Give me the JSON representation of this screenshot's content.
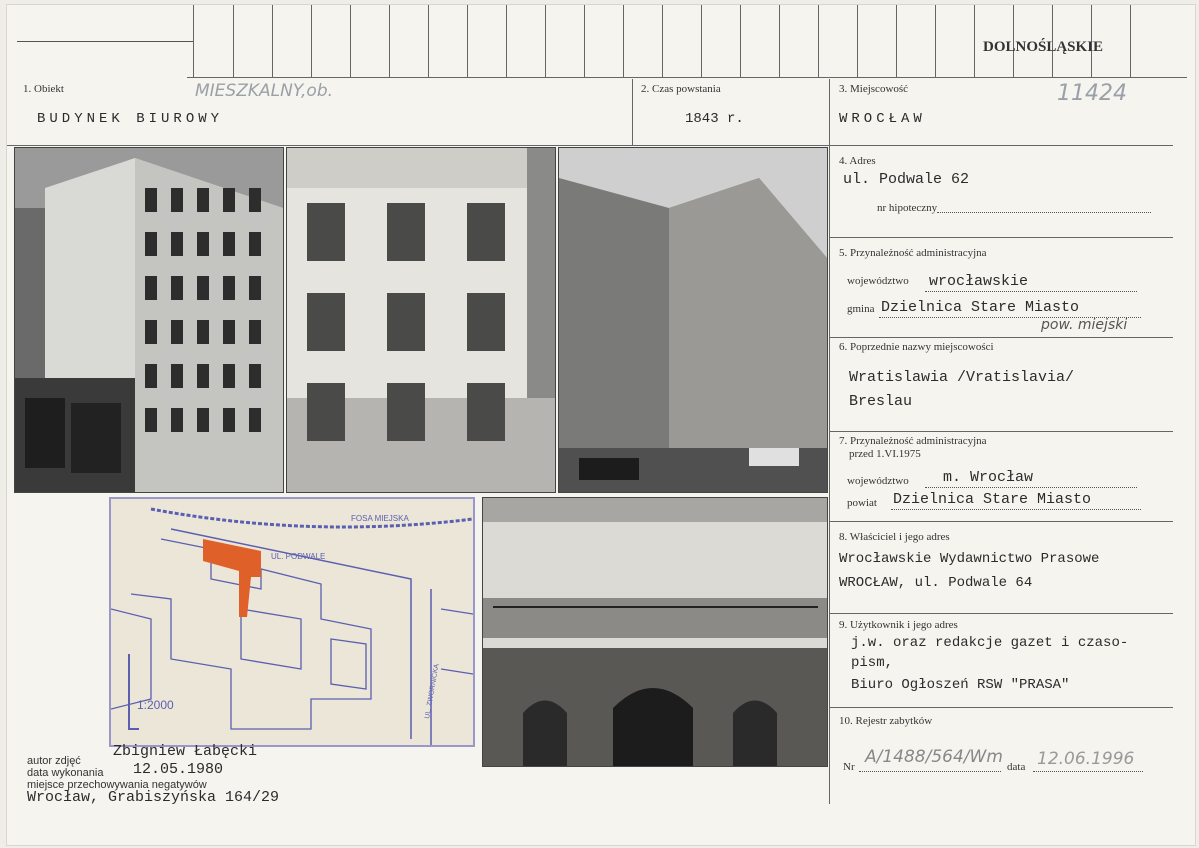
{
  "header": {
    "region_stamp": "DOLNOŚLĄSKIE"
  },
  "fields": {
    "obiekt": {
      "label": "1. Obiekt",
      "value": "BUDYNEK  BIUROWY",
      "hand_note": "MIESZKALNY,ob."
    },
    "czas": {
      "label": "2. Czas powstania",
      "value": "1843 r."
    },
    "miejscowosc": {
      "label": "3. Miejscowość",
      "value": "WROCŁAW",
      "hand_note": "11424"
    },
    "adres": {
      "label": "4. Adres",
      "value": "ul. Podwale 62",
      "sub_label": "nr hipoteczny"
    },
    "przynaleznosc": {
      "label": "5. Przynależność administracyjna",
      "woj_label": "województwo",
      "woj_value": "wrocławskie",
      "gmina_label": "gmina",
      "gmina_value": "Dzielnica Stare Miasto",
      "hand_note": "pow. miejski"
    },
    "poprzednie": {
      "label": "6. Poprzednie nazwy miejscowości",
      "line1": "Wratislawia /Vratislavia/",
      "line2": "Breslau"
    },
    "przynaleznosc_przed": {
      "label": "7. Przynależność administracyjna",
      "label2": "przed 1.VI.1975",
      "woj_label": "województwo",
      "woj_value": "m. Wrocław",
      "powiat_label": "powiat",
      "powiat_value": "Dzielnica Stare Miasto"
    },
    "wlasciciel": {
      "label": "8. Właściciel i jego adres",
      "line1": "Wrocławskie Wydawnictwo Prasowe",
      "line2": "WROCŁAW, ul. Podwale 64"
    },
    "uzytkownik": {
      "label": "9. Użytkownik i jego adres",
      "line1": "j.w. oraz redakcje gazet i czaso-",
      "line2": "pism,",
      "line3": "Biuro Ogłoszeń RSW \"PRASA\""
    },
    "rejestr": {
      "label": "10. Rejestr zabytków",
      "nr_label": "Nr",
      "nr_value": "A/1488/564/Wm",
      "data_label": "data",
      "data_value": "12.06.1996"
    }
  },
  "footer": {
    "autor_label": "autor zdjęć",
    "autor_value": "Zbigniew Łabęcki",
    "data_label": "data wykonania",
    "data_value": "12.05.1980",
    "miejsce_label": "miejsce przechowywania negatywów",
    "miejsce_value": "Wrocław, Grabiszyńska 164/29"
  },
  "map": {
    "scale": "1:2000",
    "street1": "UL. PODWALE",
    "street2": "FOSA MIEJSKA",
    "street3": "UL. ZWORNICKA",
    "accent": "#e0602a",
    "ink": "#5b5fb0"
  }
}
